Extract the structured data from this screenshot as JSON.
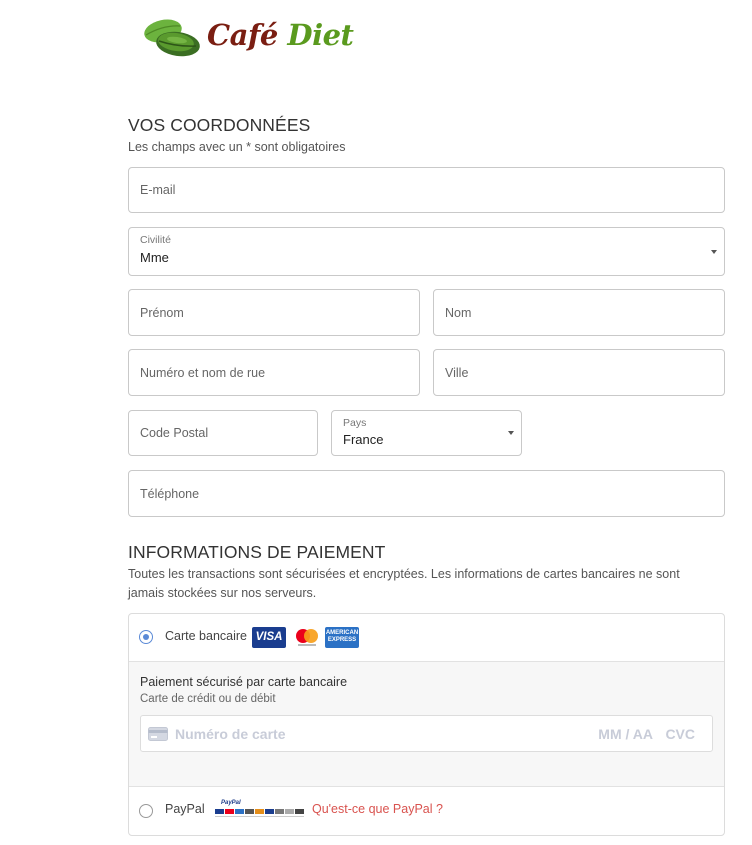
{
  "logo": {
    "word1": "Café",
    "word2": "Diet"
  },
  "coordonnees": {
    "title": "VOS COORDONNÉES",
    "subtitle": "Les champs avec un * sont obligatoires"
  },
  "fields": {
    "email": {
      "placeholder": "E-mail"
    },
    "civilite": {
      "label": "Civilité",
      "value": "Mme"
    },
    "prenom": {
      "placeholder": "Prénom"
    },
    "nom": {
      "placeholder": "Nom"
    },
    "rue": {
      "placeholder": "Numéro et nom de rue"
    },
    "ville": {
      "placeholder": "Ville"
    },
    "code_postal": {
      "placeholder": "Code Postal"
    },
    "pays": {
      "label": "Pays",
      "value": "France"
    },
    "telephone": {
      "placeholder": "Téléphone"
    }
  },
  "paiement": {
    "title": "INFORMATIONS DE PAIEMENT",
    "subtitle_line1": "Toutes les transactions sont sécurisées et encryptées. Les informations de cartes bancaires ne sont",
    "subtitle_line2": "jamais stockées sur nos serveurs.",
    "card_option": {
      "label": "Carte bancaire",
      "selected": true,
      "visa_text": "VISA",
      "amex_line1": "AMERICAN",
      "amex_line2": "EXPRESS"
    },
    "card_panel": {
      "title": "Paiement sécurisé par carte bancaire",
      "subtitle": "Carte de crédit ou de débit",
      "card_number_placeholder": "Numéro de carte",
      "expiry_placeholder": "MM / AA",
      "cvc_placeholder": "CVC"
    },
    "paypal_option": {
      "label": "PayPal",
      "selected": false,
      "badge_text": "PayPal",
      "what_is_link": "Qu'est-ce que PayPal ?"
    }
  },
  "colors": {
    "brand_brown": "#7a1e12",
    "brand_green": "#5a9a1e",
    "radio_accent": "#5b8ad6",
    "paypal_link": "#d9534f"
  }
}
